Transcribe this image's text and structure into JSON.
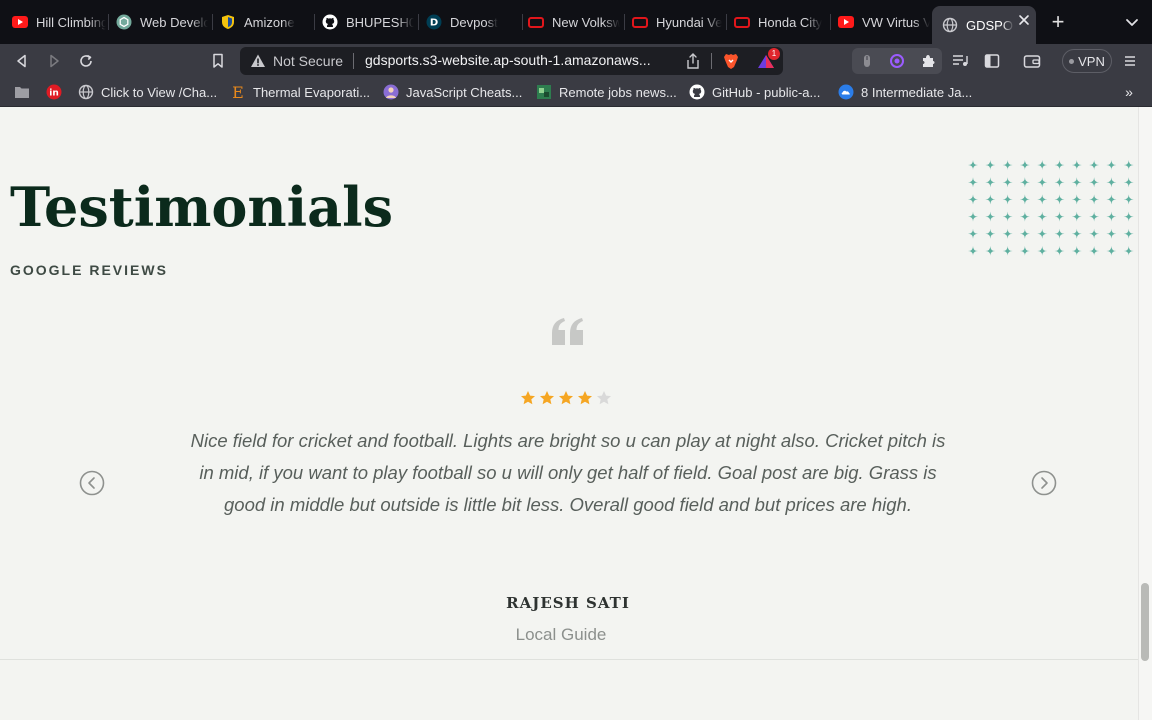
{
  "browser": {
    "tabs": [
      {
        "title": "Hill Climbing",
        "icon": "youtube-icon"
      },
      {
        "title": "Web Develo",
        "icon": "chatgpt-icon"
      },
      {
        "title": "Amizone",
        "icon": "amizone-icon"
      },
      {
        "title": "BHUPESH0",
        "icon": "github-icon"
      },
      {
        "title": "Devpost",
        "icon": "devpost-icon"
      },
      {
        "title": "New Volksw",
        "icon": "toy-icon"
      },
      {
        "title": "Hyundai Ve",
        "icon": "toy-icon"
      },
      {
        "title": "Honda City",
        "icon": "toy-icon"
      },
      {
        "title": "VW Virtus V",
        "icon": "youtube-icon"
      },
      {
        "title": "GDSPOR",
        "icon": "globe-icon",
        "active": true
      }
    ],
    "new_tab_label": "+",
    "address": {
      "security_label": "Not Secure",
      "url": "gdsports.s3-website.ap-south-1.amazonaws..."
    },
    "rewards_badge": "1",
    "vpn_label": "VPN",
    "bookmarks": [
      {
        "title": "",
        "icon": "folder-icon"
      },
      {
        "title": "",
        "icon": "linkedin-icon"
      },
      {
        "title": "Click to View /Cha...",
        "icon": "globe-icon"
      },
      {
        "title": "Thermal Evaporati...",
        "icon": "e-logo-icon"
      },
      {
        "title": "JavaScript Cheats...",
        "icon": "avatar-icon"
      },
      {
        "title": "Remote jobs news...",
        "icon": "image-icon"
      },
      {
        "title": "GitHub - public-a...",
        "icon": "github-icon"
      },
      {
        "title": "8 Intermediate Ja...",
        "icon": "cloud-icon"
      }
    ],
    "bookmarks_more": "»"
  },
  "page": {
    "heading": "Testimonials",
    "subheading": "GOOGLE REVIEWS",
    "rating": {
      "value": 4,
      "max": 5,
      "color": "#f5a623",
      "empty_color": "#d9d9d9"
    },
    "review_text": "Nice field for cricket and football. Lights are bright so u can play at night also. Cricket pitch is in mid, if you want to play football so u will only get half of field. Goal post are big. Grass is good in middle but outside is little bit less. Overall good field and but prices are high.",
    "reviewer_name": "RAJESH SATI",
    "reviewer_role": "Local Guide",
    "accent_color": "#5fb0a0",
    "heading_color": "#0b2a1c"
  }
}
